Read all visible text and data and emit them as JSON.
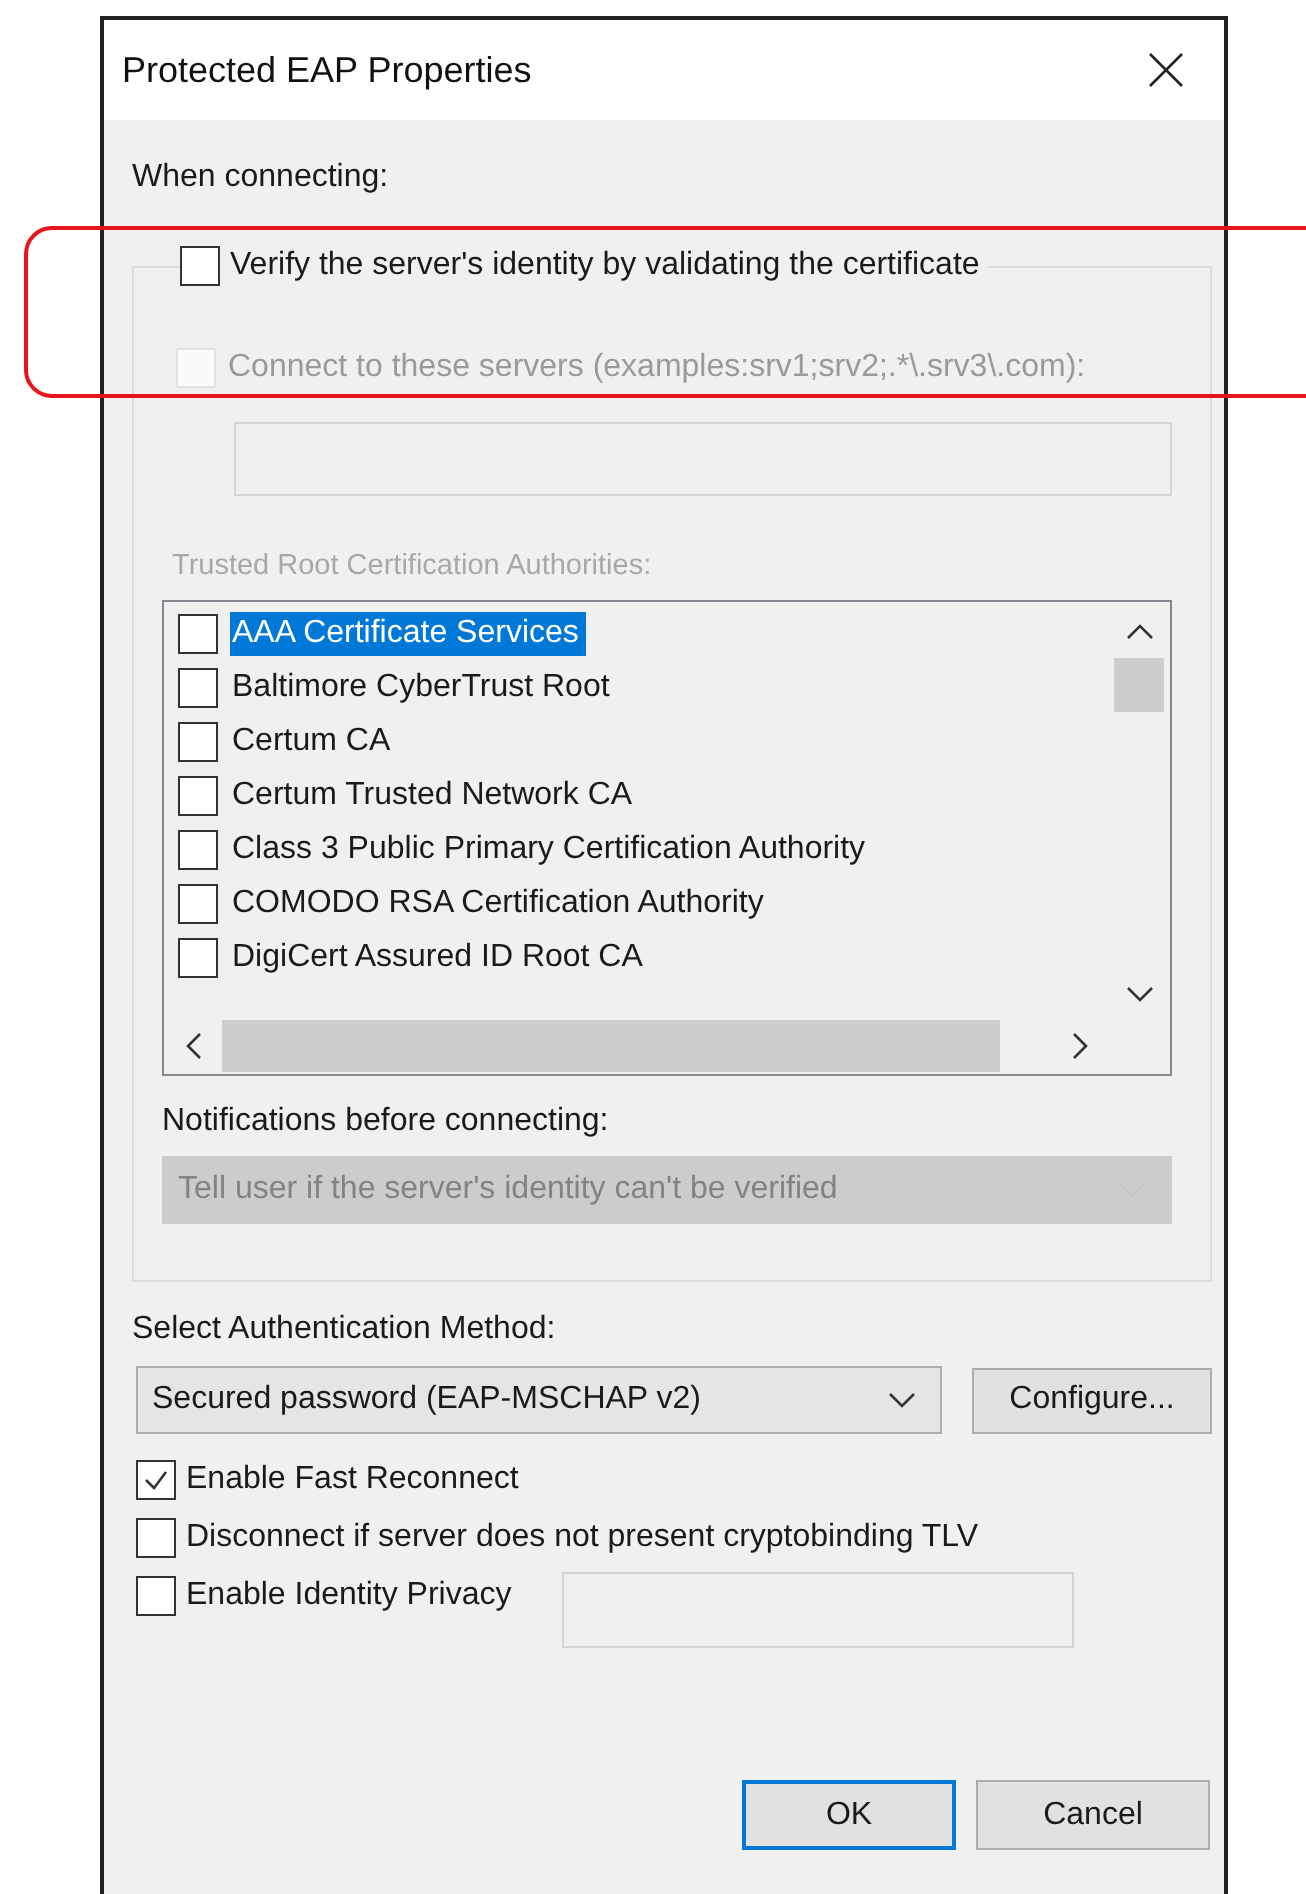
{
  "window": {
    "title": "Protected EAP Properties"
  },
  "when_connecting": {
    "label": "When connecting:",
    "verify": {
      "label": "Verify the server's identity by validating the certificate",
      "checked": false
    },
    "connect_servers": {
      "label": "Connect to these servers (examples:srv1;srv2;.*\\.srv3\\.com):",
      "checked": false,
      "disabled": true
    },
    "trusted_root_label": {
      "text": "Trusted Root Certification Authorities:",
      "disabled": true
    },
    "certificates": [
      {
        "name": "AAA Certificate Services",
        "checked": false,
        "selected": true
      },
      {
        "name": "Baltimore CyberTrust Root",
        "checked": false,
        "selected": false
      },
      {
        "name": "Certum CA",
        "checked": false,
        "selected": false
      },
      {
        "name": "Certum Trusted Network CA",
        "checked": false,
        "selected": false
      },
      {
        "name": "Class 3 Public Primary Certification Authority",
        "checked": false,
        "selected": false
      },
      {
        "name": "COMODO RSA Certification Authority",
        "checked": false,
        "selected": false
      },
      {
        "name": "DigiCert Assured ID Root CA",
        "checked": false,
        "selected": false
      }
    ],
    "notifications_label": "Notifications before connecting:",
    "notifications_dropdown": {
      "value": "Tell user if the server's identity can't be verified",
      "disabled": true
    }
  },
  "authentication": {
    "label": "Select Authentication Method:",
    "method": {
      "value": "Secured password (EAP-MSCHAP v2)"
    },
    "configure_button": "Configure..."
  },
  "options": [
    {
      "label": "Enable Fast Reconnect",
      "checked": true,
      "kind": "plain"
    },
    {
      "label": "Disconnect if server does not present cryptobinding TLV",
      "checked": false,
      "kind": "plain"
    },
    {
      "label": "Enable Identity Privacy",
      "checked": false,
      "kind": "with-field"
    }
  ],
  "buttons": [
    {
      "label": "OK",
      "default": true
    },
    {
      "label": "Cancel",
      "default": false
    }
  ]
}
